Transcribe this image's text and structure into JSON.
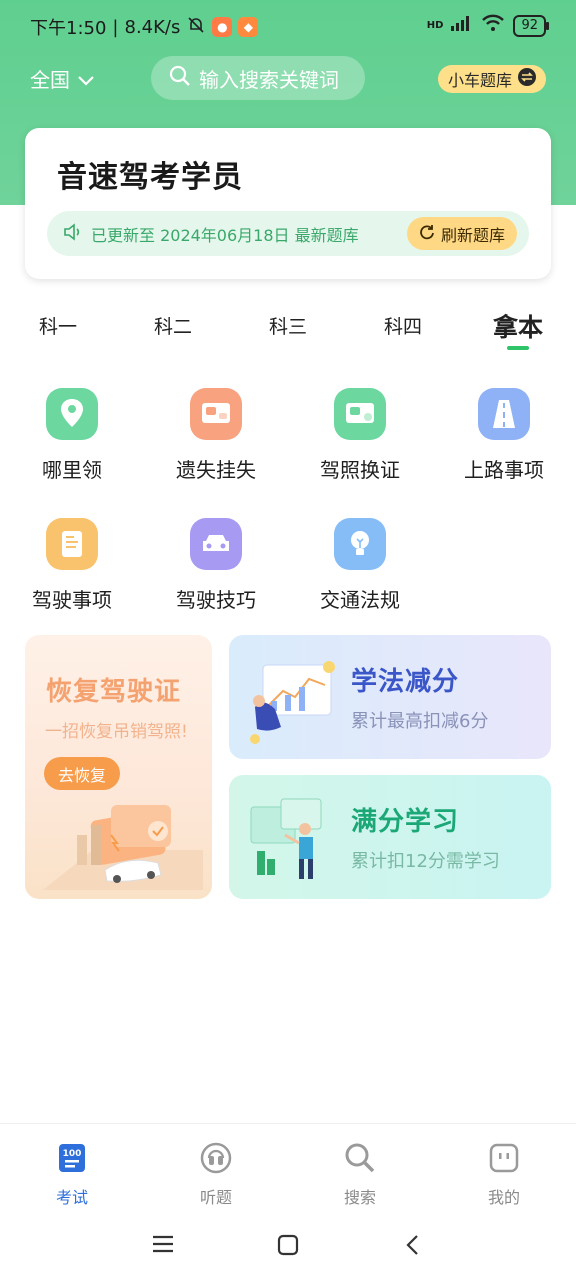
{
  "status_bar": {
    "time": "下午1:50",
    "speed": "8.4K/s",
    "network": "HD",
    "battery": "92"
  },
  "header": {
    "region": "全国",
    "search_placeholder": "输入搜索关键词",
    "bank_button": "小车题库"
  },
  "card": {
    "title": "音速驾考学员",
    "update_text": "已更新至 2024年06月18日 最新题库",
    "refresh_button": "刷新题库"
  },
  "tabs": [
    {
      "label": "科一"
    },
    {
      "label": "科二"
    },
    {
      "label": "科三"
    },
    {
      "label": "科四"
    },
    {
      "label": "拿本"
    }
  ],
  "active_tab": "拿本",
  "grid": [
    {
      "label": "哪里领",
      "icon": "location-pin-icon",
      "color": "#6dd7a0"
    },
    {
      "label": "遗失挂失",
      "icon": "lost-report-icon",
      "color": "#f8a27f"
    },
    {
      "label": "驾照换证",
      "icon": "license-renew-icon",
      "color": "#6dd7a0"
    },
    {
      "label": "上路事项",
      "icon": "road-icon",
      "color": "#8fb1f5"
    },
    {
      "label": "驾驶事项",
      "icon": "notebook-icon",
      "color": "#f9c26c"
    },
    {
      "label": "驾驶技巧",
      "icon": "car-icon",
      "color": "#a79af2"
    },
    {
      "label": "交通法规",
      "icon": "lightbulb-icon",
      "color": "#86bdf7"
    }
  ],
  "promo": {
    "left": {
      "title": "恢复驾驶证",
      "subtitle": "一招恢复吊销驾照!",
      "button": "去恢复"
    },
    "right_top": {
      "title": "学法减分",
      "subtitle": "累计最高扣减6分"
    },
    "right_bottom": {
      "title": "满分学习",
      "subtitle": "累计扣12分需学习"
    }
  },
  "bottom_nav": [
    {
      "label": "考试",
      "icon": "exam-icon"
    },
    {
      "label": "听题",
      "icon": "listen-icon"
    },
    {
      "label": "搜索",
      "icon": "search-icon"
    },
    {
      "label": "我的",
      "icon": "profile-icon"
    }
  ],
  "active_nav": "考试",
  "colors": {
    "brand_green": "#5fcf8f",
    "accent_blue": "#2f6fdc",
    "accent_yellow": "#ffe08a"
  }
}
